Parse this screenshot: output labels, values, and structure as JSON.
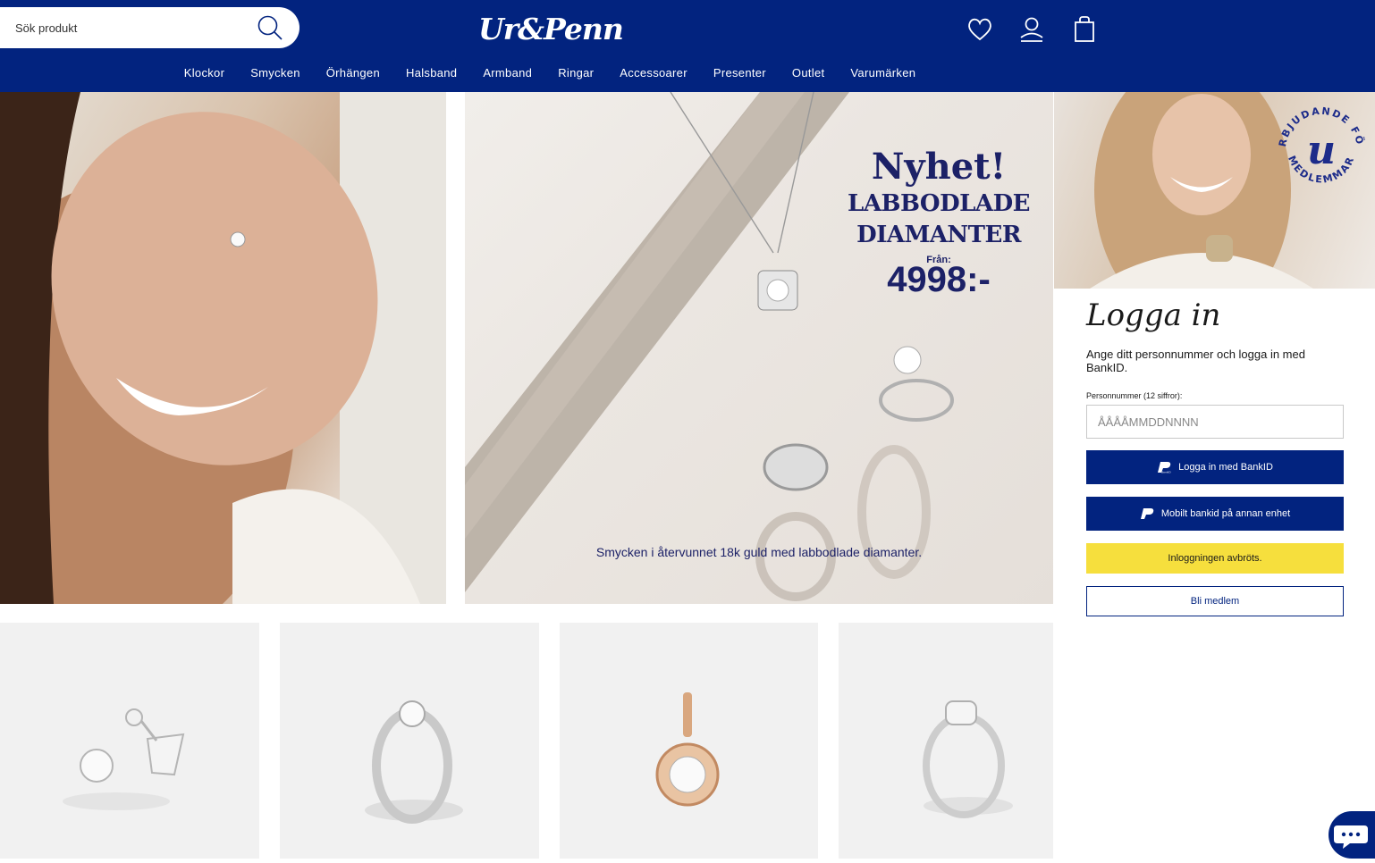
{
  "header": {
    "search_placeholder": "Sök produkt",
    "logo": "Ur&Penn"
  },
  "nav": [
    "Klockor",
    "Smycken",
    "Örhängen",
    "Halsband",
    "Armband",
    "Ringar",
    "Accessoarer",
    "Presenter",
    "Outlet",
    "Varumärken"
  ],
  "hero": {
    "heading": "Nyhet!",
    "subheading_1": "LABBODLADE",
    "subheading_2": "DIAMANTER",
    "from_label": "Från:",
    "price": "4998:-",
    "caption": "Smycken i återvunnet 18k guld med labbodlade diamanter."
  },
  "member_badge": {
    "text_top": "ERBJUDANDE FÖR",
    "text_bottom": "MEDLEMMAR",
    "monogram": "u"
  },
  "login": {
    "title": "Logga in",
    "description": "Ange ditt personnummer och logga in med BankID.",
    "pn_label": "Personnummer (12 siffror):",
    "pn_placeholder": "ÅÅÅÅMMDDNNNN",
    "bankid_button": "Logga in med BankID",
    "mobile_button": "Mobilt bankid på annan enhet",
    "status": "Inloggningen avbröts.",
    "member_button": "Bli medlem"
  },
  "colors": {
    "brand_blue": "#02237f",
    "alert_yellow": "#f6df3d"
  }
}
